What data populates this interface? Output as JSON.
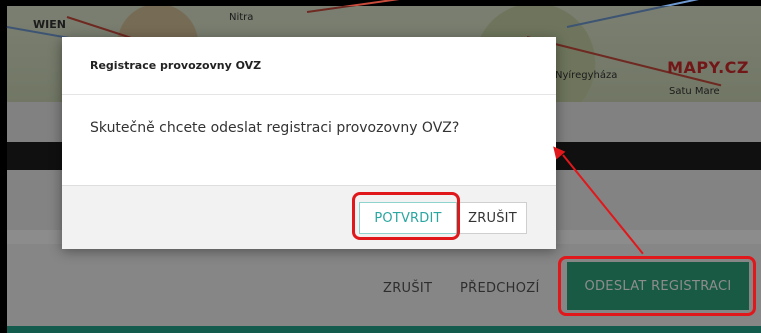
{
  "map": {
    "labels": [
      "WIEN",
      "Nitra",
      "Nyíregyháza",
      "Satu Mare"
    ],
    "logo": "MAPY.CZ"
  },
  "page_footer": {
    "cancel_label": "ZRUŠIT",
    "previous_label": "PŘEDCHOZÍ",
    "submit_label": "ODESLAT REGISTRACI"
  },
  "modal": {
    "title": "Registrace provozovny OVZ",
    "message": "Skutečně chcete odeslat registraci provozovny OVZ?",
    "confirm_label": "POTVRDIT",
    "cancel_label": "ZRUŠIT"
  },
  "colors": {
    "annotation": "#e0181b",
    "primary": "#2da57a",
    "confirm_text": "#2aa6a0"
  }
}
